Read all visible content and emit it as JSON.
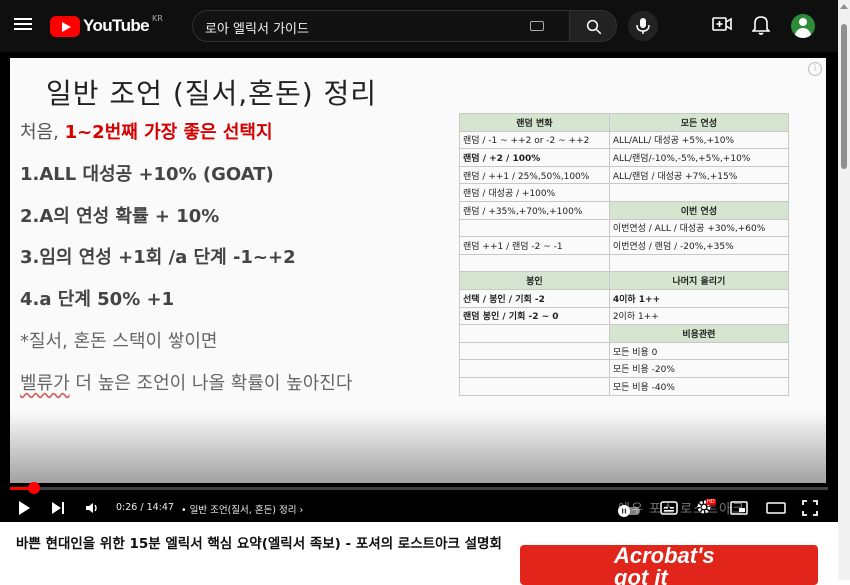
{
  "header": {
    "logo_text": "YouTube",
    "logo_region": "KR",
    "search_value": "로아 엘릭서 가이드",
    "icons": [
      "menu-icon",
      "youtube-logo-icon",
      "keyboard-icon",
      "search-icon",
      "mic-icon",
      "create-icon",
      "bell-icon",
      "avatar-icon"
    ]
  },
  "slide": {
    "title": "일반 조언 (질서,혼돈) 정리",
    "intro_prefix": "처음, ",
    "intro_highlight": "1~2번째 가장 좋은 선택지",
    "points": [
      "1.ALL 대성공 +10% (GOAT)",
      "2.A의 연성 확률 + 10%",
      "3.임의 연성 +1회 /a 단계 -1~+2",
      "4.a 단계 50% +1"
    ],
    "note_1": "*질서, 혼돈 스택이 쌓이면",
    "note_2_underlined": "벨류가",
    "note_2_rest": " 더 높은 조언이 나올 확률이 높아진다",
    "table": {
      "rows": [
        [
          "랜덤 변화",
          "모든 연성"
        ],
        [
          "랜덤 / -1 ~ ++2 or -2 ~ ++2",
          "ALL/ALL/ 대성공 +5%,+10%"
        ],
        [
          "랜덤 / +2 / 100%",
          "ALL/랜덤/-10%,-5%,+5%,+10%"
        ],
        [
          "랜덤 / ++1 / 25%,50%,100%",
          "ALL/랜덤 / 대성공 +7%,+15%"
        ],
        [
          "랜덤 / 대성공 / +100%",
          ""
        ],
        [
          "랜덤 / +35%,+70%,+100%",
          "이번 연성"
        ],
        [
          "",
          "이번연성 / ALL / 대성공 +30%,+60%"
        ],
        [
          "랜덤 ++1 / 랜덤 -2 ~ -1",
          "이번연성 / 랜덤 / -20%,+35%"
        ],
        [
          "",
          ""
        ],
        [
          "봉인",
          "나머지 올리기"
        ],
        [
          "선택 / 봉인 / 기회 -2",
          "4이하 1++"
        ],
        [
          "랜덤 봉인 / 기회 -2 ~ 0",
          "2이하 1++"
        ],
        [
          "",
          "비용관련"
        ],
        [
          "",
          "모든 비용 0"
        ],
        [
          "",
          "모든 비용 -20%"
        ],
        [
          "",
          "모든 비용 -40%"
        ]
      ]
    }
  },
  "player": {
    "current_time": "0:26",
    "duration": "14:47",
    "time_display": "0:26 / 14:47",
    "chapter": "• 일반 조언(질서, 혼돈) 정리 ›",
    "progress_fraction": 0.029,
    "buffer_fraction": 0.036,
    "watermark": "예우 포스 로스트아크",
    "hd_label": "HD",
    "icons": [
      "play-icon",
      "next-icon",
      "volume-icon",
      "autoplay-toggle-icon",
      "subtitles-icon",
      "settings-icon",
      "miniplayer-icon",
      "theater-icon",
      "fullscreen-icon"
    ]
  },
  "video": {
    "title": "바쁜 현대인을 위한 15분 엘릭서 핵심 요약(엘릭서 족보) - 포셔의 로스트아크 설명회"
  },
  "ad": {
    "text": "Acrobat's\ngot it"
  }
}
